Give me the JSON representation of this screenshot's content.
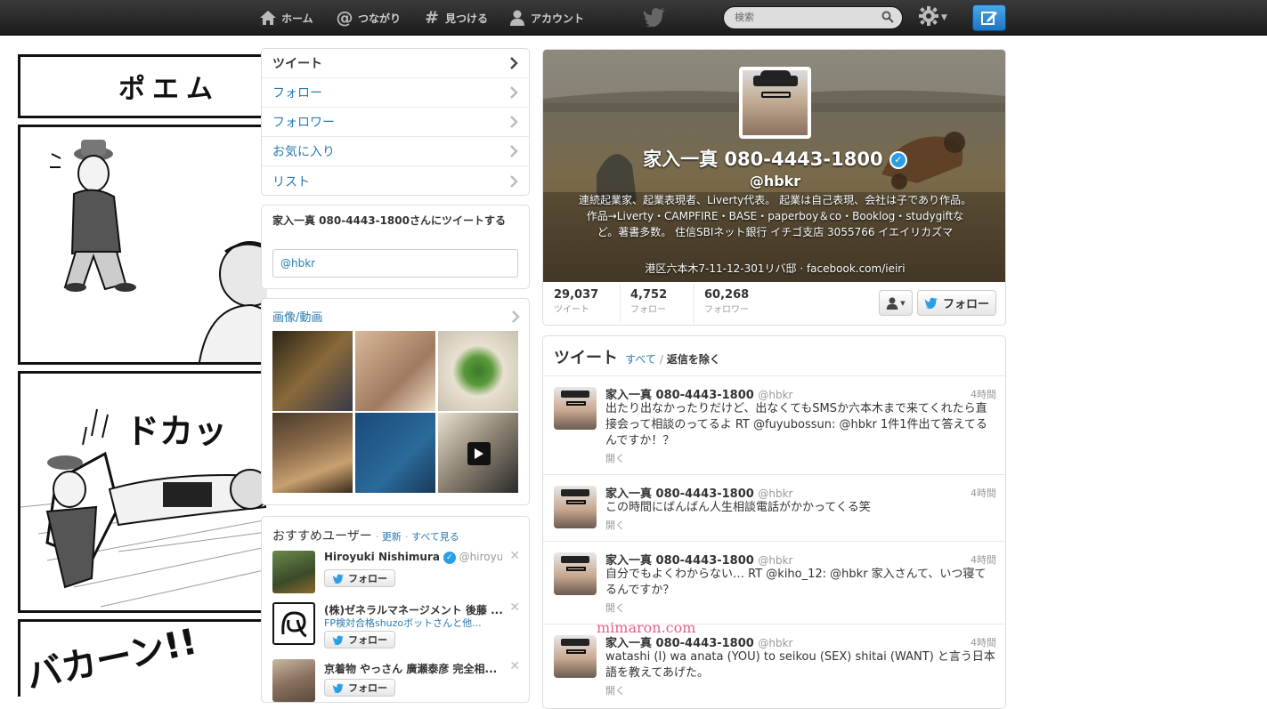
{
  "nav": {
    "home": "ホーム",
    "connect": "つながり",
    "discover": "見つける",
    "account": "アカウント",
    "search_placeholder": "検索"
  },
  "comic": {
    "title": "ポエム",
    "sfx1": "ドカッ",
    "sfx2": "バカーン!!"
  },
  "sidenav": {
    "items": [
      {
        "label": "ツイート"
      },
      {
        "label": "フォロー"
      },
      {
        "label": "フォロワー"
      },
      {
        "label": "お気に入り"
      },
      {
        "label": "リスト"
      }
    ]
  },
  "tweetto": {
    "title": "家入一真 080-4443-1800さんにツイートする",
    "value": "@hbkr"
  },
  "media": {
    "title": "画像/動画"
  },
  "wtf": {
    "title": "おすすめユーザー",
    "refresh": "更新",
    "view_all": "すべて見る",
    "follow_label": "フォロー",
    "users": [
      {
        "name": "Hiroyuki Nishimura",
        "handle": "@hiroyu...",
        "sub": ""
      },
      {
        "name": "(株)ゼネラルマネージメント 後藤 ...",
        "handle": "",
        "sub": "FP検対合格shuzoボットさんと他..."
      },
      {
        "name": "京着物 やっさん 廣瀬泰彦 完全相...",
        "handle": "",
        "sub": ""
      }
    ]
  },
  "profile": {
    "name": "家入一真 080-4443-1800",
    "handle": "@hbkr",
    "bio": "連続起業家、起業表現者、Liverty代表。 起業は自己表現、会社は子であり作品。作品→Liverty・CAMPFIRE・BASE・paperboy＆co・Booklog・studygiftなど。著書多数。 住信SBIネット銀行 イチゴ支店 3055766 イエイリカズマ",
    "location": "港区六本木7-11-12-301リバ邸",
    "url": "facebook.com/ieiri",
    "stats": [
      {
        "value": "29,037",
        "label": "ツイート"
      },
      {
        "value": "4,752",
        "label": "フォロー"
      },
      {
        "value": "60,268",
        "label": "フォロワー"
      }
    ],
    "follow_label": "フォロー"
  },
  "timeline": {
    "title": "ツイート",
    "filter_all": "すべて",
    "filter_noreplies": "返信を除く",
    "open_label": "開く",
    "tweets": [
      {
        "name": "家入一真 080-4443-1800",
        "handle": "@hbkr",
        "time": "4時間",
        "text": "出たり出なかったりだけど、出なくてもSMSか六本木まで来てくれたら直接会って相談のってるよ RT @fuyubossun: @hbkr 1件1件出て答えてるんですか！？"
      },
      {
        "name": "家入一真 080-4443-1800",
        "handle": "@hbkr",
        "time": "4時間",
        "text": "この時間にばんばん人生相談電話がかかってくる笑"
      },
      {
        "name": "家入一真 080-4443-1800",
        "handle": "@hbkr",
        "time": "4時間",
        "text": "自分でもよくわからない… RT @kiho_12: @hbkr 家入さんて、いつ寝てるんですか？"
      },
      {
        "name": "家入一真 080-4443-1800",
        "handle": "@hbkr",
        "time": "4時間",
        "text": "watashi (I) wa anata (YOU) to seikou (SEX) shitai (WANT) と言う日本語を教えてあげた。"
      }
    ]
  },
  "watermark": "mimaron.com",
  "colors": {
    "link": "#2a7ab0",
    "verified": "#2a9fe6",
    "topbar": "#2a2a2a"
  }
}
